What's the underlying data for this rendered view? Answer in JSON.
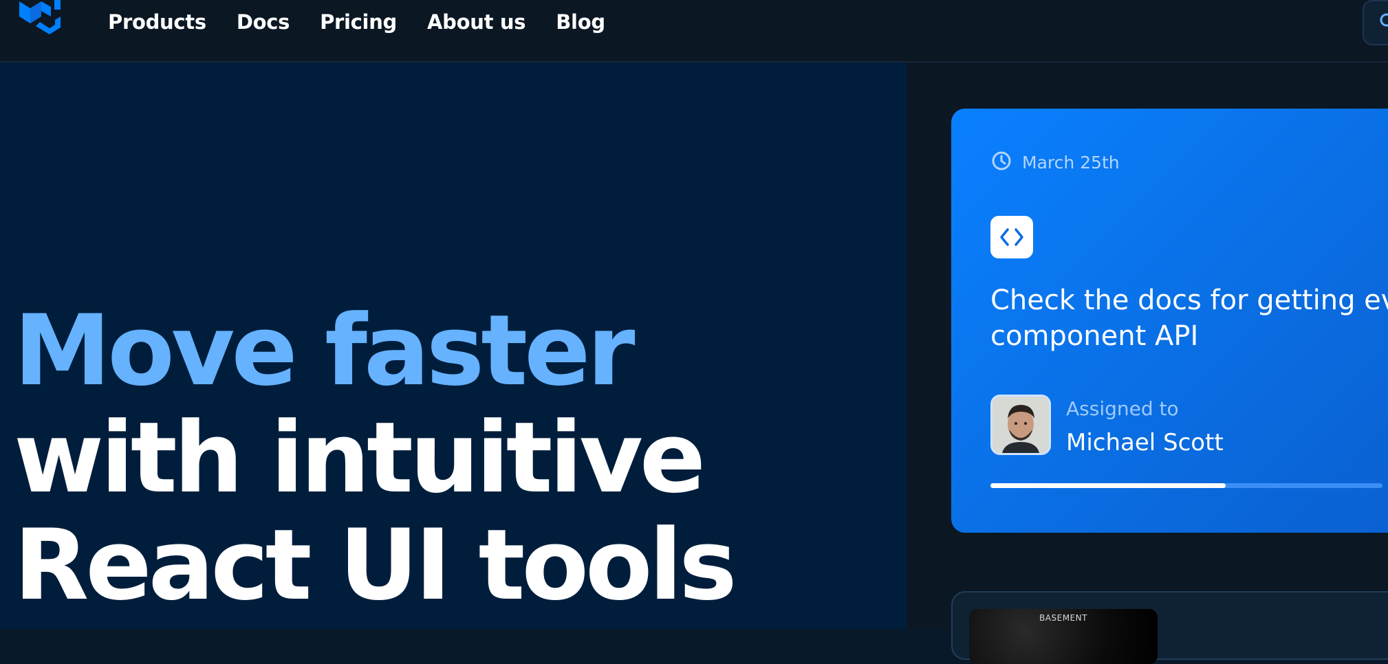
{
  "header": {
    "logo_icon": "mui-logo-icon",
    "nav": [
      {
        "label": "Products"
      },
      {
        "label": "Docs"
      },
      {
        "label": "Pricing"
      },
      {
        "label": "About us"
      },
      {
        "label": "Blog"
      }
    ],
    "search_icon": "search-icon"
  },
  "hero": {
    "line1": "Move faster",
    "line2": "with intuitive",
    "line3": "React UI tools",
    "accent_color": "#66b2ff"
  },
  "task_card": {
    "date": "March 25th",
    "date_icon": "clock-icon",
    "badge_icon": "code-icon",
    "title_line1": "Check the docs for getting ev",
    "title_line2": "component API",
    "assigned_label": "Assigned to",
    "assignee": "Michael Scott",
    "progress": 0.6
  },
  "album_card": {
    "album_title": "BASEMENT"
  }
}
